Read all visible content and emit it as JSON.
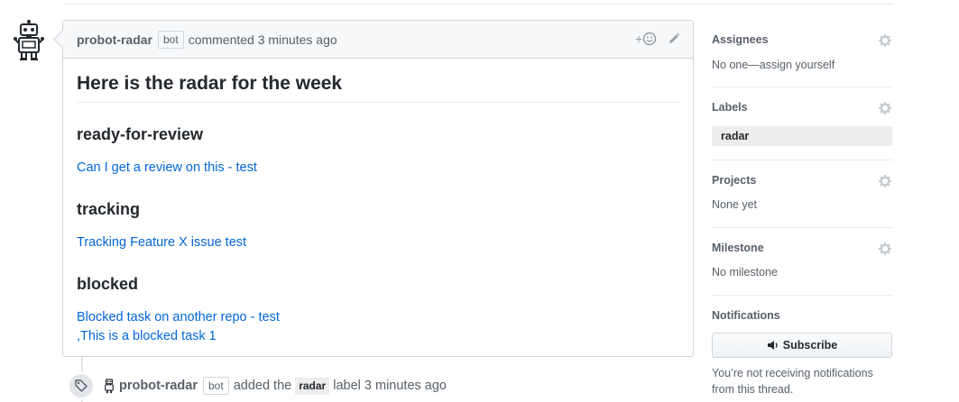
{
  "comment": {
    "author": "probot-radar",
    "badge": "bot",
    "action": "commented 3 minutes ago",
    "title": "Here is the radar for the week",
    "sections": [
      {
        "heading": "ready-for-review",
        "links": [
          "Can I get a review on this - test"
        ]
      },
      {
        "heading": "tracking",
        "links": [
          "Tracking Feature X issue test"
        ]
      },
      {
        "heading": "blocked",
        "links": [
          "Blocked task on another repo - test",
          ",This is a blocked task 1"
        ]
      }
    ],
    "reaction_plus": "+",
    "icons": {
      "reaction": "smiley-icon",
      "edit": "pencil-icon"
    }
  },
  "event": {
    "author": "probot-radar",
    "badge": "bot",
    "text_before": "added the",
    "label": "radar",
    "text_after": "label 3 minutes ago",
    "icon": "tag-icon"
  },
  "sidebar": {
    "assignees": {
      "title": "Assignees",
      "value": "No one—assign yourself"
    },
    "labels": {
      "title": "Labels",
      "value": "radar"
    },
    "projects": {
      "title": "Projects",
      "value": "None yet"
    },
    "milestone": {
      "title": "Milestone",
      "value": "No milestone"
    },
    "notifications": {
      "title": "Notifications",
      "button": "Subscribe",
      "note_line1": "You’re not receiving notifications",
      "note_line2": "from this thread."
    }
  },
  "colors": {
    "link": "#0366d6",
    "label_bg": "#ededed",
    "border": "#d1d5da"
  }
}
